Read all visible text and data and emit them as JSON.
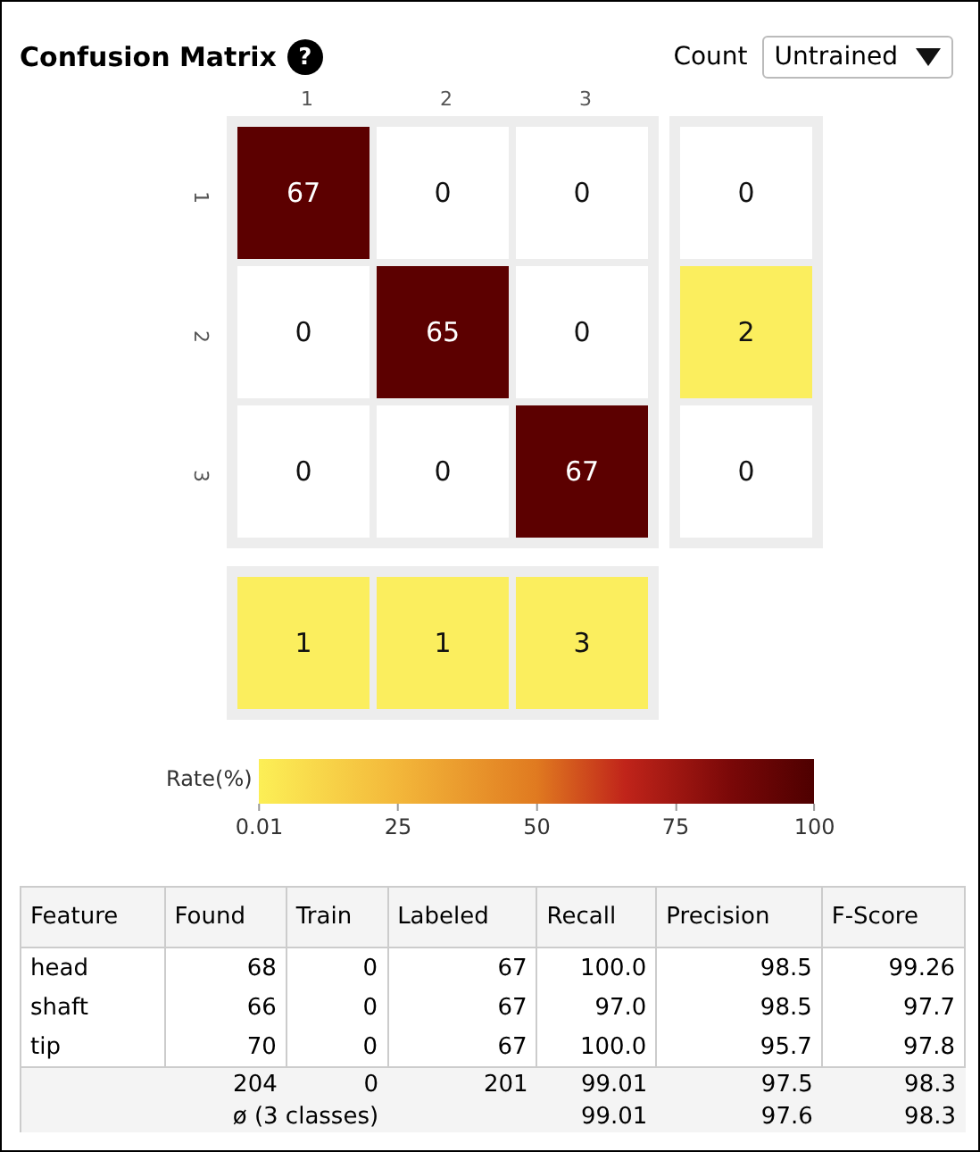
{
  "title": "Confusion Matrix",
  "help_icon": "?",
  "count_label": "Count",
  "dropdown": {
    "value": "Untrained"
  },
  "column_labels": [
    "1",
    "2",
    "3"
  ],
  "row_labels": [
    "1",
    "2",
    "3"
  ],
  "matrix": [
    [
      {
        "value": "67",
        "color": "#5c0000"
      },
      {
        "value": "0",
        "color": "#ffffff"
      },
      {
        "value": "0",
        "color": "#ffffff"
      }
    ],
    [
      {
        "value": "0",
        "color": "#ffffff"
      },
      {
        "value": "65",
        "color": "#5c0000"
      },
      {
        "value": "0",
        "color": "#ffffff"
      }
    ],
    [
      {
        "value": "0",
        "color": "#ffffff"
      },
      {
        "value": "0",
        "color": "#ffffff"
      },
      {
        "value": "67",
        "color": "#5c0000"
      }
    ]
  ],
  "row_totals": [
    {
      "value": "0",
      "color": "#ffffff"
    },
    {
      "value": "2",
      "color": "#fbee5e"
    },
    {
      "value": "0",
      "color": "#ffffff"
    }
  ],
  "column_totals": [
    {
      "value": "1",
      "color": "#fbee5e"
    },
    {
      "value": "1",
      "color": "#fbee5e"
    },
    {
      "value": "3",
      "color": "#fbee5e"
    }
  ],
  "colorbar": {
    "label": "Rate(%)",
    "ticks": [
      "0.01",
      "25",
      "50",
      "75",
      "100"
    ]
  },
  "table": {
    "columns": [
      "Feature",
      "Found",
      "Train",
      "Labeled",
      "Recall",
      "Precision",
      "F-Score"
    ],
    "rows": [
      [
        "head",
        "68",
        "0",
        "67",
        "100.0",
        "98.5",
        "99.26"
      ],
      [
        "shaft",
        "66",
        "0",
        "67",
        "97.0",
        "98.5",
        "97.7"
      ],
      [
        "tip",
        "70",
        "0",
        "67",
        "100.0",
        "95.7",
        "97.8"
      ]
    ],
    "totals": [
      "204",
      "0",
      "201",
      "99.01",
      "97.5",
      "98.3"
    ],
    "averages": {
      "label": "ø (3 classes)",
      "values": [
        "99.01",
        "97.6",
        "98.3"
      ]
    }
  }
}
